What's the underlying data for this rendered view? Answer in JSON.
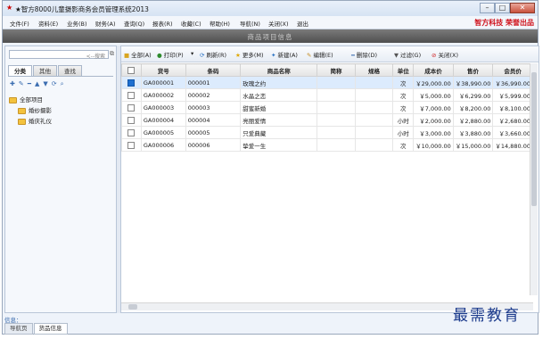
{
  "window": {
    "title": "★智方8000儿童摄影商务会员管理系统2013"
  },
  "menu": [
    "文件(F)",
    "资料(E)",
    "业务(B)",
    "财务(A)",
    "查询(Q)",
    "报表(R)",
    "收藏(C)",
    "帮助(H)",
    "导航(N)",
    "关闭(X)",
    "退出"
  ],
  "brand": "智方科技 荣誉出品",
  "banner_title": "商品项目信息",
  "left_panel": {
    "search_placeholder": "<--搜索",
    "tabs": [
      "分类",
      "其他",
      "查找"
    ],
    "tree": {
      "root": "全部项目",
      "children": [
        "婚纱摄影",
        "婚庆礼仪"
      ]
    }
  },
  "toolbar": {
    "all": "全部(A)",
    "print": "打印(P)",
    "refresh": "刷新(R)",
    "more": "更多(M)",
    "new": "新建(A)",
    "edit": "编辑(E)",
    "delete": "删除(D)",
    "filter": "过滤(G)",
    "close": "关闭(X)"
  },
  "grid": {
    "columns": [
      "货号",
      "条码",
      "商品名称",
      "简称",
      "规格",
      "单位",
      "成本价",
      "售价",
      "会员价"
    ],
    "rows": [
      {
        "code": "GA000001",
        "barcode": "000001",
        "name": "玫瑰之约",
        "abbr": "",
        "spec": "",
        "unit": "次",
        "cost": "￥29,000.00",
        "price": "￥38,990.00",
        "member": "￥36,990.00",
        "selected": true
      },
      {
        "code": "GA000002",
        "barcode": "000002",
        "name": "水晶之恋",
        "abbr": "",
        "spec": "",
        "unit": "次",
        "cost": "￥5,000.00",
        "price": "￥6,299.00",
        "member": "￥5,999.00",
        "selected": false
      },
      {
        "code": "GA000003",
        "barcode": "000003",
        "name": "甜蜜新婚",
        "abbr": "",
        "spec": "",
        "unit": "次",
        "cost": "￥7,000.00",
        "price": "￥8,200.00",
        "member": "￥8,100.00",
        "selected": false
      },
      {
        "code": "GA000004",
        "barcode": "000004",
        "name": "亮丽爱情",
        "abbr": "",
        "spec": "",
        "unit": "小时",
        "cost": "￥2,000.00",
        "price": "￥2,880.00",
        "member": "￥2,680.00",
        "selected": false
      },
      {
        "code": "GA000005",
        "barcode": "000005",
        "name": "只爱典藏",
        "abbr": "",
        "spec": "",
        "unit": "小时",
        "cost": "￥3,000.00",
        "price": "￥3,880.00",
        "member": "￥3,660.00",
        "selected": false
      },
      {
        "code": "GA000006",
        "barcode": "000006",
        "name": "挚爱一生",
        "abbr": "",
        "spec": "",
        "unit": "次",
        "cost": "￥10,000.00",
        "price": "￥15,000.00",
        "member": "￥14,880.00",
        "selected": false
      }
    ]
  },
  "status_text": "信息：",
  "bottom_tabs": [
    "导航页",
    "货品信息"
  ],
  "watermark": "最需教育"
}
